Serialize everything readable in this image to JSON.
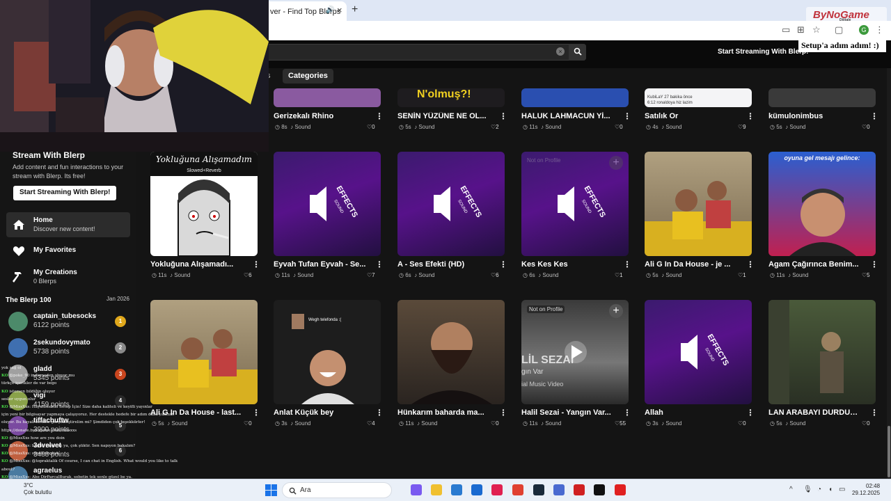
{
  "browser": {
    "tab_title": "ver - Find Top Blerps",
    "tab_close": "×",
    "new_tab": "+",
    "overlay_brand": "ByNoGame",
    "overlay_brand_sub": "Dijitale"
  },
  "header": {
    "search_placeholder": "",
    "cta": "Start Streaming With Blerp!",
    "overlay_caption": "Setup'a adım adım! :)"
  },
  "filters": {
    "partial_tab": "s",
    "categories": "Categories"
  },
  "sidebar": {
    "promo_title": "Stream With Blerp",
    "promo_desc": "Add content and fun interactions to your stream with Blerp. Its free!",
    "promo_button": "Start Streaming With Blerp!",
    "nav": [
      {
        "title": "Home",
        "sub": "Discover new content!"
      },
      {
        "title": "My Favorites",
        "sub": ""
      },
      {
        "title": "My Creations",
        "sub": "0 Blerps"
      }
    ],
    "blerp100_title": "The Blerp 100",
    "blerp100_date": "Jan 2026",
    "leaderboard": [
      {
        "name": "captain_tubesocks",
        "points": "6122 points",
        "rank": "1",
        "color": "#e0a81c"
      },
      {
        "name": "2sekundovymato",
        "points": "5738 points",
        "rank": "2",
        "color": "#8a8a8a"
      },
      {
        "name": "gladd",
        "points": "5345 points",
        "rank": "3",
        "color": "#c9451e"
      },
      {
        "name": "vigi",
        "points": "4159 points",
        "rank": "4",
        "color": "#2a2a2a"
      },
      {
        "name": "tiffachuftw",
        "points": "3900 points",
        "rank": "5",
        "color": "#2a2a2a"
      },
      {
        "name": "3dvelvet",
        "points": "3488 points",
        "rank": "6",
        "color": "#2a2a2a"
      },
      {
        "name": "agraelus",
        "points": "",
        "rank": "",
        "color": "#2a2a2a"
      }
    ]
  },
  "grid": {
    "row_top": [
      {
        "title": "Gerizekalı Rhino",
        "duration": "8s",
        "type": "Sound",
        "likes": "0"
      },
      {
        "title": "SENİN YÜZÜNE NE OL...",
        "duration": "5s",
        "type": "Sound",
        "likes": "2",
        "thumb_text": "N'olmuş?!"
      },
      {
        "title": "HALUK LAHMACUN Yİ...",
        "duration": "11s",
        "type": "Sound",
        "likes": "0"
      },
      {
        "title": "Satılık Or",
        "duration": "4s",
        "type": "Sound",
        "likes": "9",
        "thumb_text": "KubiLaY 27 bakika önce",
        "thumb_text2": "6:12 ronaldoya hiz lazim"
      },
      {
        "title": "kümulonimbus",
        "duration": "5s",
        "type": "Sound",
        "likes": "0"
      }
    ],
    "row_mid": [
      {
        "title": "Yokluğuna Alışamadı...",
        "duration": "11s",
        "type": "Sound",
        "likes": "6",
        "thumb_text": "Yokluğuna Alışamadım",
        "thumb_text2": "Slowed+Reverb"
      },
      {
        "title": "Eyvah Tufan Eyvah - Se...",
        "duration": "11s",
        "type": "Sound",
        "likes": "7"
      },
      {
        "title": "A - Ses Efekti (HD)",
        "duration": "6s",
        "type": "Sound",
        "likes": "6"
      },
      {
        "title": "Kes Kes Kes",
        "duration": "6s",
        "type": "Sound",
        "likes": "1",
        "badge": "Not on Profile"
      },
      {
        "title": "Ali G In Da House - je ...",
        "duration": "5s",
        "type": "Sound",
        "likes": "1"
      },
      {
        "title": "Agam Çağırınca Benim...",
        "duration": "11s",
        "type": "Sound",
        "likes": "5",
        "thumb_text": "oyuna gel mesajı gelince:"
      }
    ],
    "row_bot": [
      {
        "title": "Ali G In Da House - last...",
        "duration": "5s",
        "type": "Sound",
        "likes": "0"
      },
      {
        "title": "Anlat Küçük bey",
        "duration": "3s",
        "type": "Sound",
        "likes": "4",
        "thumb_text": "Wegh telefonda :("
      },
      {
        "title": "Hünkarım baharda ma...",
        "duration": "11s",
        "type": "Sound",
        "likes": "0"
      },
      {
        "title": "Halil Sezai - Yangın Var...",
        "duration": "11s",
        "type": "Sound",
        "likes": "55",
        "badge": "Not on Profile",
        "thumb_text": "LİL SEZAİ",
        "thumb_text2": "gın Var",
        "thumb_text3": "ial Music Video"
      },
      {
        "title": "Allah",
        "duration": "3s",
        "type": "Sound",
        "likes": "0"
      },
      {
        "title": "LAN ARABAYI DURDUR...",
        "duration": "5s",
        "type": "Sound",
        "likes": "0"
      }
    ],
    "effects_label": "EFFECTS",
    "effects_sub": "SOUND"
  },
  "chat": [
    {
      "prefix": "",
      "text": "yok sağ ol"
    },
    {
      "prefix": "KO",
      "text": "@poke_90 indirmeden oluyor mu"
    },
    {
      "prefix": "",
      "text": "türkçe içerikler de var bego"
    },
    {
      "prefix": "KO",
      "text": "istersen bildiğin oluyor"
    },
    {
      "prefix": "",
      "text": "sesler uygun olur"
    },
    {
      "prefix": "KO",
      "text": "@MissXxs: Hayallimdeki Setup İçin! Size daha kaliteli ve keyifli yayınlar"
    },
    {
      "prefix": "",
      "text": "için yeni bir bilgisayar yapmaya çalışıyoruz. Her destekle hedefe bir adım daha yakınız!"
    },
    {
      "prefix": "",
      "text": "oluyor. Bu hayali birlikte gerçekleştirelim mi? Şimdiden çok teşekkürler!"
    },
    {
      "prefix": "",
      "text": "https://donate.bynogame.com/missxxs"
    },
    {
      "prefix": "KO",
      "text": "@MissXxs how are you doin"
    },
    {
      "prefix": "KO",
      "text": "@MissXxs: bugün yayın ne ya, çok şükür. Sen napıyon bakalım?"
    },
    {
      "prefix": "KO",
      "text": "@MissXxs: speak english"
    },
    {
      "prefix": "KO",
      "text": "@MissXxs: @topraktalik Of course, I can chat in English. What would you like to talk"
    },
    {
      "prefix": "",
      "text": "about?"
    },
    {
      "prefix": "KO",
      "text": "@MissXxs: Abe DirParcalBurak, sobetin tek senle güzel be ya."
    },
    {
      "prefix": "",
      "text": "Çok hululu"
    }
  ],
  "taskbar": {
    "weather_temp": "3°C",
    "weather_desc": "Çok bulutlu",
    "search": "Ara",
    "time": "02:48",
    "date": "29.12.2025"
  },
  "colors": {
    "background": "#141414",
    "accent_purple": "#57128a",
    "sidebar": "#151515"
  }
}
